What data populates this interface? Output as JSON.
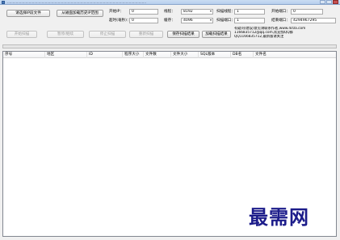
{
  "window": {
    "title": "…………………………………………………………………………………………………………………"
  },
  "toolbar": {
    "select_file_button": "请选择IP段文件",
    "load_history_button": "从磁盘加载历史IP范围",
    "start_scan_button": "开始扫描",
    "pause_button": "暂停/继续",
    "stop_button": "停止扫描",
    "rescan_button": "重新扫描",
    "save_results_button": "保存扫描结果",
    "load_results_button": "加载扫描结果"
  },
  "settings": {
    "start_ip_label": "开始IP：",
    "start_ip_value": "0",
    "timeout_label": "超时(毫秒)：",
    "timeout_value": "0",
    "threads_label": "线程：",
    "threads_value": "8192",
    "buffer_label": "缓存：",
    "buffer_value": "4096",
    "scan_thread_label": "扫描线程：",
    "scan_thread_value": "1",
    "scan_port_label": "扫描端口：",
    "scan_port_value": "1",
    "start_port_label": "开始端口：",
    "start_port_value": "0",
    "end_port_label": "结束端口：",
    "end_port_value": "4294967295"
  },
  "info": {
    "line1": "有疑问/建议/意见请联系作者,www.4c0a.com",
    "line2": "1166835712@qq.com,欢迎加QQ群",
    "line3": "QQ1166835712,最新版请关注"
  },
  "progress": {
    "value": 0
  },
  "list": {
    "columns": [
      "序号",
      "地区",
      "ID",
      "程序大小",
      "文件数",
      "文件大小",
      "SQL版本",
      "DB名",
      "文件名"
    ]
  },
  "watermark": {
    "text": "最需网"
  }
}
